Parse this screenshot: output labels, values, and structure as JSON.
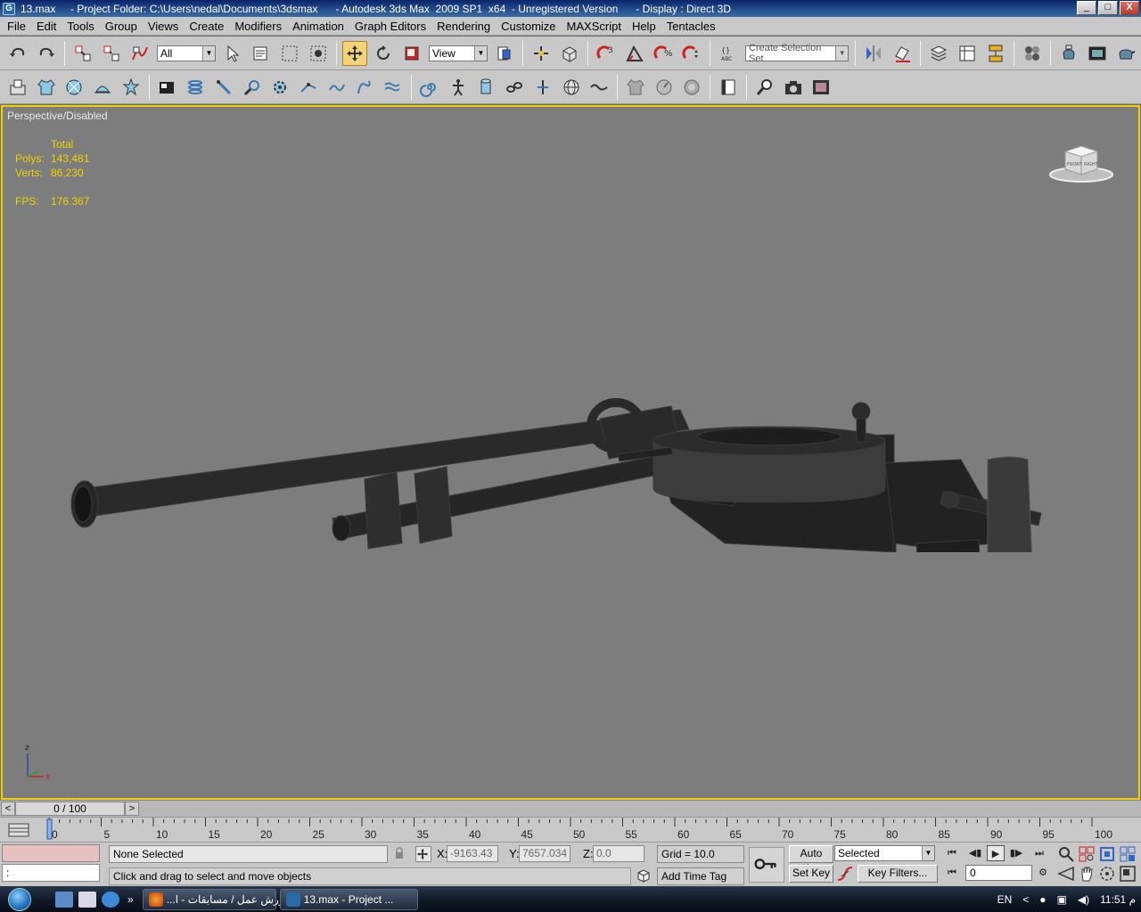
{
  "window": {
    "title": "13.max     - Project Folder: C:\\Users\\nedal\\Documents\\3dsmax      - Autodesk 3ds Max  2009 SP1  x64  - Unregistered Version      - Display : Direct 3D",
    "app_icon_label": "G",
    "buttons": {
      "minimize": "_",
      "maximize": "□",
      "close": "X"
    }
  },
  "menu": [
    "File",
    "Edit",
    "Tools",
    "Group",
    "Views",
    "Create",
    "Modifiers",
    "Animation",
    "Graph Editors",
    "Rendering",
    "Customize",
    "MAXScript",
    "Help",
    "Tentacles"
  ],
  "toolbar": {
    "selection_filter": "All",
    "reference_coord": "View",
    "named_selection_set_placeholder": "Create Selection Set"
  },
  "viewport": {
    "label": "Perspective/Disabled",
    "stats": {
      "header": "Total",
      "polys_label": "Polys:",
      "polys_value": "143,481",
      "verts_label": "Verts:",
      "verts_value": "86,230",
      "fps_label": "FPS:",
      "fps_value": "176.367"
    },
    "viewcube": {
      "front": "FRONT",
      "right": "RIGHT"
    },
    "axis": {
      "z": "z",
      "x": "x"
    },
    "colors": {
      "background": "#7d7d7d",
      "active_border": "#f0d000",
      "stats_text": "#f0d000"
    }
  },
  "timeslider": {
    "frame_label": "0 / 100",
    "left_arrow": "<",
    "right_arrow": ">"
  },
  "trackbar": {
    "ticks": [
      "0",
      "5",
      "10",
      "15",
      "20",
      "25",
      "30",
      "35",
      "40",
      "45",
      "50",
      "55",
      "60",
      "65",
      "70",
      "75",
      "80",
      "85",
      "90",
      "95",
      "100"
    ]
  },
  "status": {
    "maxscript_listener": ":",
    "selection_info": "None Selected",
    "prompt": "Click and drag to select and move objects",
    "x_label": "X:",
    "x_value": "-9163.43",
    "y_label": "Y:",
    "y_value": "7657.034",
    "z_label": "Z:",
    "z_value": "0.0",
    "grid": "Grid = 10.0",
    "add_time_tag": "Add Time Tag",
    "auto_key": "Auto Key",
    "set_key": "Set Key",
    "key_mode": "Selected",
    "key_filters": "Key Filters...",
    "current_frame": "0"
  },
  "taskbar": {
    "chevron": "»",
    "tasks": [
      {
        "label": "...ورش عمل / مسابقات - ا"
      },
      {
        "label": "13.max     - Project ..."
      }
    ],
    "language": "EN",
    "tray_chevron": "<",
    "clock": "11:51 م"
  }
}
